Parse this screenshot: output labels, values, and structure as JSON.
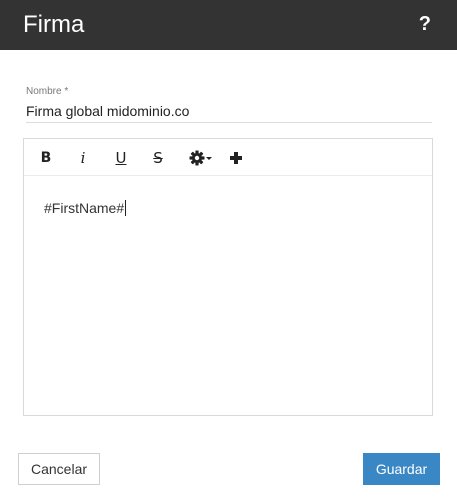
{
  "dialog": {
    "title": "Firma",
    "help_label": "?"
  },
  "form": {
    "name_label": "Nombre *",
    "name_value": "Firma global midominio.co"
  },
  "editor": {
    "toolbar": {
      "bold": "B",
      "italic": "i",
      "underline": "U",
      "strikethrough": "S",
      "settings_icon": "gear-icon",
      "add_icon": "plus-icon"
    },
    "content": "#FirstName#"
  },
  "footer": {
    "cancel_label": "Cancelar",
    "save_label": "Guardar"
  },
  "colors": {
    "titlebar": "#333333",
    "primary": "#3a87c6"
  }
}
